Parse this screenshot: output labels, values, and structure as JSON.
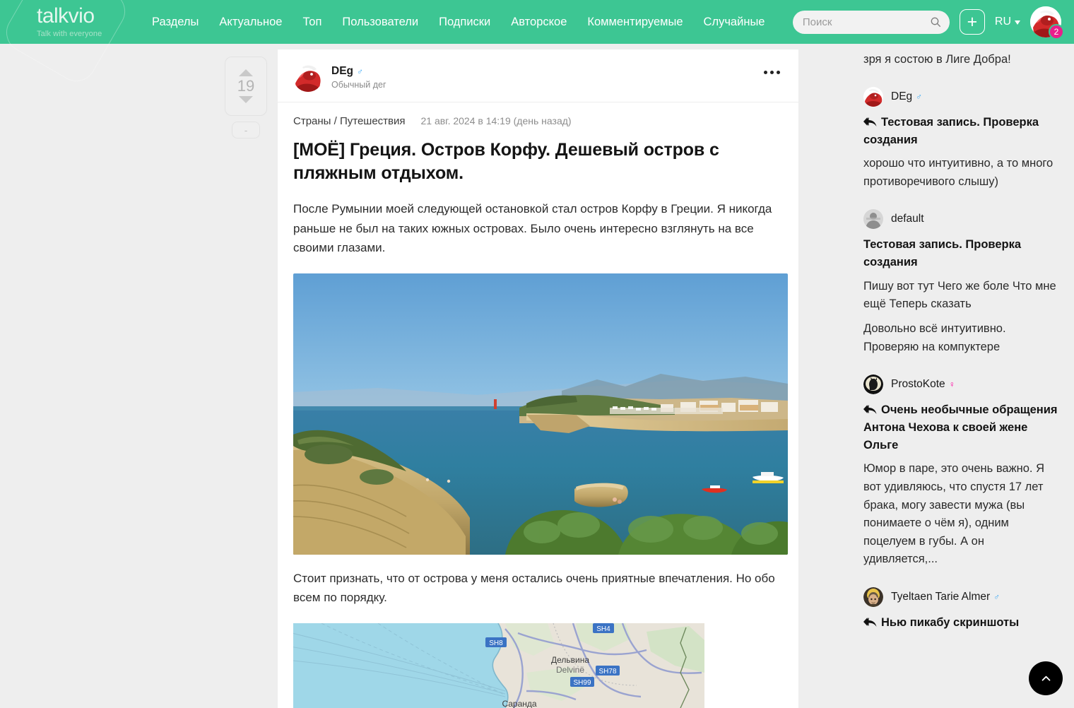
{
  "header": {
    "logo": "talkvio",
    "logo_tagline": "Talk with everyone",
    "nav": [
      {
        "label": "Разделы"
      },
      {
        "label": "Актуальное"
      },
      {
        "label": "Топ"
      },
      {
        "label": "Пользователи"
      },
      {
        "label": "Подписки"
      },
      {
        "label": "Авторское"
      },
      {
        "label": "Комментируемые"
      },
      {
        "label": "Случайные"
      }
    ],
    "search_placeholder": "Поиск",
    "search_value": "",
    "create_label": "+",
    "language": "RU",
    "notifications_count": "2",
    "brand_color": "#3dc693",
    "badge_color": "#e91e8c"
  },
  "vote": {
    "score": "19",
    "minus_label": "-"
  },
  "post": {
    "author": "DEg",
    "author_gender": "♂",
    "author_subtitle": "Обычный дег",
    "menu_label": "•••",
    "category": "Страны / Путешествия",
    "date": "21 авг. 2024 в 14:19 (день назад)",
    "tag": "[МОЁ]",
    "title": " Греция. Остров Корфу. Дешевый остров с пляжным отдыхом.",
    "paragraph1": "После Румынии моей следующей остановкой стал остров Корфу в Греции. Я никогда раньше не был на таких южных островах. Было очень интересно взглянуть на все своими глазами.",
    "paragraph2": "Стоит признать, что от острова у меня остались очень приятные впечатления. Но обо всем по порядку.",
    "photo_alt": "Корфу — Канал любви, бухта с лодками",
    "map_alt": "Карта побережья Албании",
    "map_labels": {
      "road1": "SH8",
      "road2": "SH4",
      "road3": "SH78",
      "road4": "SH99",
      "city_ru": "Дельвина",
      "city_lat": "Delvinë",
      "city2_ru": "Саранда"
    }
  },
  "sidebar": {
    "tail_text": "зря я состою в Лиге Добра!",
    "comments": [
      {
        "user": "DEg",
        "gender": "♂",
        "gender_kind": "m",
        "has_reply_icon": true,
        "title": "Тестовая запись. Проверка создания",
        "texts": [
          "хорошо что интуитивно, а то много противоречивого слышу)"
        ]
      },
      {
        "user": "default",
        "gender": "",
        "gender_kind": "none",
        "has_reply_icon": false,
        "title": "Тестовая запись. Проверка создания",
        "texts": [
          "Пишу вот тут Чего же боле Что мне ещё Теперь сказать",
          "Довольно всё интуитивно. Проверяю на компуктере"
        ]
      },
      {
        "user": "ProstoKote",
        "gender": "♀",
        "gender_kind": "f",
        "has_reply_icon": true,
        "title": "Очень необычные обращения Антона Чехова к своей жене Ольге",
        "texts": [
          "Юмор в паре, это очень важно. Я вот удивляюсь, что спустя 17 лет брака, могу завести мужа (вы понимаете о чём я), одним поцелуем в губы.  А он удивляется,..."
        ]
      },
      {
        "user": "Tyeltaen Tarie Almer",
        "gender": "♂",
        "gender_kind": "m",
        "has_reply_icon": true,
        "title": "Нью пикабу скриншоты",
        "texts": []
      }
    ]
  },
  "scroll_top": {
    "icon": "chevron-up-icon"
  }
}
